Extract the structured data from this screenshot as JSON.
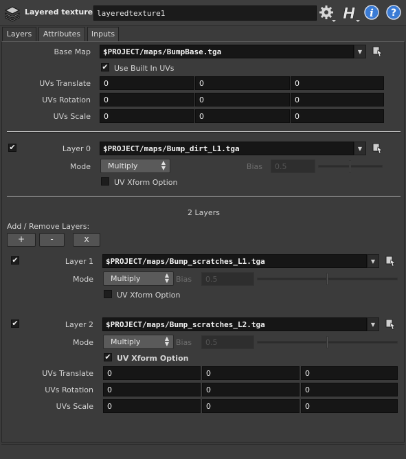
{
  "header": {
    "node_type": "Layered texture",
    "node_name": "layeredtexture1",
    "icons": [
      "layers-icon",
      "gear-icon",
      "houdini-help-icon",
      "info-icon",
      "help-icon"
    ]
  },
  "tabs": [
    {
      "label": "Layers",
      "active": true
    },
    {
      "label": "Attributes",
      "active": false
    },
    {
      "label": "Inputs",
      "active": false
    }
  ],
  "base": {
    "map_label": "Base Map",
    "map_value": "$PROJECT/maps/BumpBase.tga",
    "use_builtin_label": "Use Built In UVs",
    "use_builtin_checked": true,
    "uv_translate_label": "UVs Translate",
    "uv_translate": [
      "0",
      "0",
      "0"
    ],
    "uv_rotation_label": "UVs Rotation",
    "uv_rotation": [
      "0",
      "0",
      "0"
    ],
    "uv_scale_label": "UVs Scale",
    "uv_scale": [
      "0",
      "0",
      "0"
    ]
  },
  "layer0": {
    "enabled": true,
    "label": "Layer 0",
    "file": "$PROJECT/maps/Bump_dirt_L1.tga",
    "mode_label": "Mode",
    "mode": "Multiply",
    "bias_label": "Bias",
    "bias": "0.5",
    "bias_fraction": 0.5,
    "uv_xform_label": "UV Xform Option",
    "uv_xform_checked": false
  },
  "multiparm": {
    "count_label": "2 Layers",
    "add_remove_label": "Add / Remove Layers:",
    "add_label": "+",
    "remove_label": "-",
    "clear_label": "x"
  },
  "layer1": {
    "enabled": true,
    "label": "Layer 1",
    "file": "$PROJECT/maps/Bump_scratches_L1.tga",
    "mode_label": "Mode",
    "mode": "Multiply",
    "bias_label": "Bias",
    "bias": "0.5",
    "bias_fraction": 0.5,
    "uv_xform_label": "UV Xform Option",
    "uv_xform_checked": false
  },
  "layer2": {
    "enabled": true,
    "label": "Layer 2",
    "file": "$PROJECT/maps/Bump_scratches_L2.tga",
    "mode_label": "Mode",
    "mode": "Multiply",
    "bias_label": "Bias",
    "bias": "0.5",
    "bias_fraction": 0.5,
    "uv_xform_label": "UV Xform Option",
    "uv_xform_checked": true,
    "uv_translate_label": "UVs Translate",
    "uv_translate": [
      "0",
      "0",
      "0"
    ],
    "uv_rotation_label": "UVs Rotation",
    "uv_rotation": [
      "0",
      "0",
      "0"
    ],
    "uv_scale_label": "UVs Scale",
    "uv_scale": [
      "0",
      "0",
      "0"
    ]
  },
  "colors": {
    "background": "#3b3b3b",
    "field_bg": "#161616",
    "info_icon": "#3a7bd5",
    "help_icon": "#3a7bd5"
  }
}
